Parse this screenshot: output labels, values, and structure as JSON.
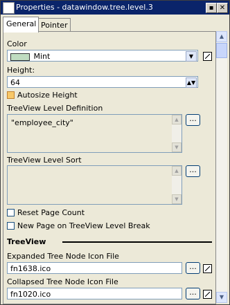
{
  "window": {
    "title": "Properties - datawindow.tree.level.3",
    "minimize_glyph": "▪",
    "close_glyph": "✕"
  },
  "tabs": [
    {
      "label": "General",
      "active": true
    },
    {
      "label": "Pointer",
      "active": false
    }
  ],
  "color": {
    "label": "Color",
    "value": "Mint",
    "swatch_hex": "#c0dcc0"
  },
  "height": {
    "label": "Height:",
    "value": "64"
  },
  "autosize": {
    "label": "Autosize Height",
    "checked": false
  },
  "level_definition": {
    "label": "TreeView Level Definition",
    "value": "\"employee_city\""
  },
  "level_sort": {
    "label": "TreeView Level Sort",
    "value": ""
  },
  "reset_page_count": {
    "label": "Reset Page Count",
    "checked": false
  },
  "new_page_break": {
    "label": "New Page on TreeView Level Break",
    "checked": false
  },
  "treeview_section": {
    "label": "TreeView"
  },
  "expanded_icon": {
    "label": "Expanded Tree Node Icon File",
    "value": "fn1638.ico"
  },
  "collapsed_icon": {
    "label": "Collapsed Tree Node Icon File",
    "value": "fn1020.ico"
  },
  "ellipsis_label": "..."
}
